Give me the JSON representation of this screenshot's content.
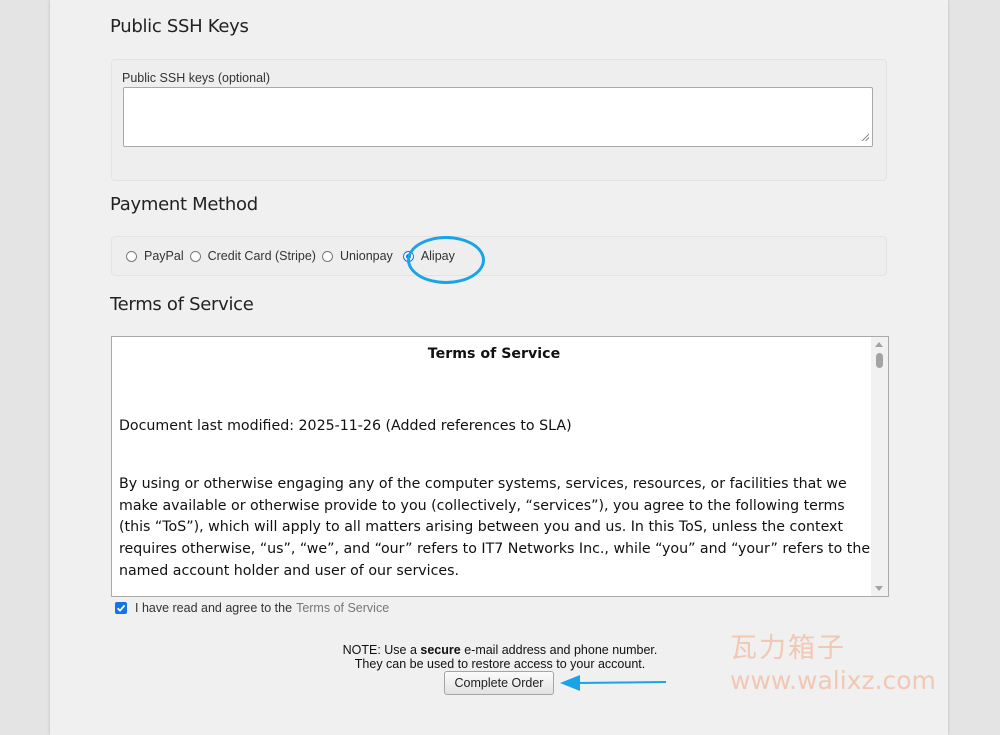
{
  "ssh": {
    "section_title": "Public SSH Keys",
    "field_label": "Public SSH keys (optional)",
    "field_value": ""
  },
  "payment": {
    "section_title": "Payment Method",
    "options": [
      {
        "label": "PayPal",
        "checked": false
      },
      {
        "label": "Credit Card (Stripe)",
        "checked": false
      },
      {
        "label": "Unionpay",
        "checked": false
      },
      {
        "label": "Alipay",
        "checked": true
      }
    ]
  },
  "tos": {
    "section_title": "Terms of Service",
    "heading": "Terms of Service",
    "modified": "Document last modified: 2025-11-26 (Added references to SLA)",
    "paragraph": "By using or otherwise engaging any of the computer systems, services, resources, or facilities that we make available or otherwise provide to you (collectively, “services”), you agree to the following terms (this “ToS”), which will apply to all matters arising between you and us. In this ToS, unless the context requires otherwise, “us”, “we”, and “our” refers to IT7 Networks Inc., while “you” and “your” refers to the named account holder and user of our services."
  },
  "agree": {
    "checked": true,
    "text": "I have read and agree to the",
    "link": "Terms of Service"
  },
  "note": {
    "prefix": "NOTE: Use a",
    "bold": "secure",
    "suffix": "e-mail address and phone number.",
    "line2": "They can be used to restore access to your account."
  },
  "submit": {
    "label": "Complete Order"
  },
  "watermark": {
    "cn": "瓦力箱子",
    "url": "www.walixz.com"
  },
  "colors": {
    "annotation": "#19a3e8",
    "accent": "#1473e6",
    "watermark": "#f0a078"
  }
}
